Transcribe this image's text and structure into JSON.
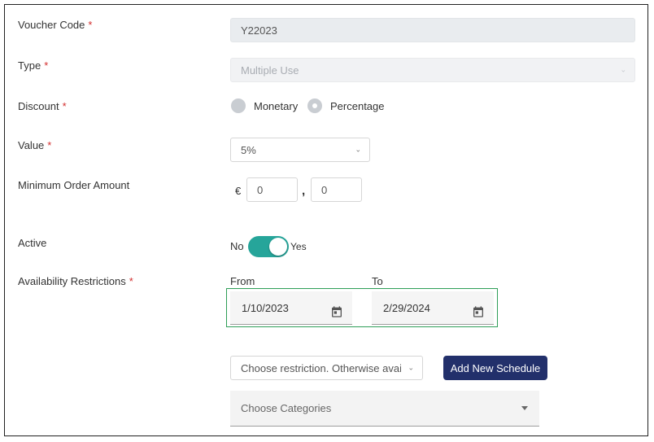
{
  "form": {
    "voucher_code": {
      "label": "Voucher Code",
      "required": "*",
      "value": "Y22023"
    },
    "type": {
      "label": "Type",
      "required": "*",
      "value": "Multiple Use"
    },
    "discount": {
      "label": "Discount",
      "required": "*",
      "options": [
        "Monetary",
        "Percentage"
      ],
      "selected": "Percentage"
    },
    "value": {
      "label": "Value",
      "required": "*",
      "selected": "5%"
    },
    "minimum_order": {
      "label": "Minimum Order Amount",
      "currency": "€",
      "whole": "0",
      "separator": ",",
      "cents": "0"
    },
    "active": {
      "label": "Active",
      "off_label": "No",
      "on_label": "Yes",
      "state": "on"
    },
    "availability": {
      "label": "Availability Restrictions",
      "required": "*",
      "from_label": "From",
      "from_value": "1/10/2023",
      "to_label": "To",
      "to_value": "2/29/2024",
      "restriction_placeholder": "Choose restriction. Otherwise avail",
      "add_schedule_label": "Add New Schedule",
      "categories_placeholder": "Choose Categories"
    }
  },
  "colors": {
    "toggle_on": "#26a59a",
    "button": "#22306b",
    "required": "#d32f2f",
    "date_highlight": "#2e9e57"
  },
  "icons": {
    "calendar": "calendar-icon",
    "chevron": "chevron-down-icon",
    "dropdown": "caret-down-icon"
  }
}
